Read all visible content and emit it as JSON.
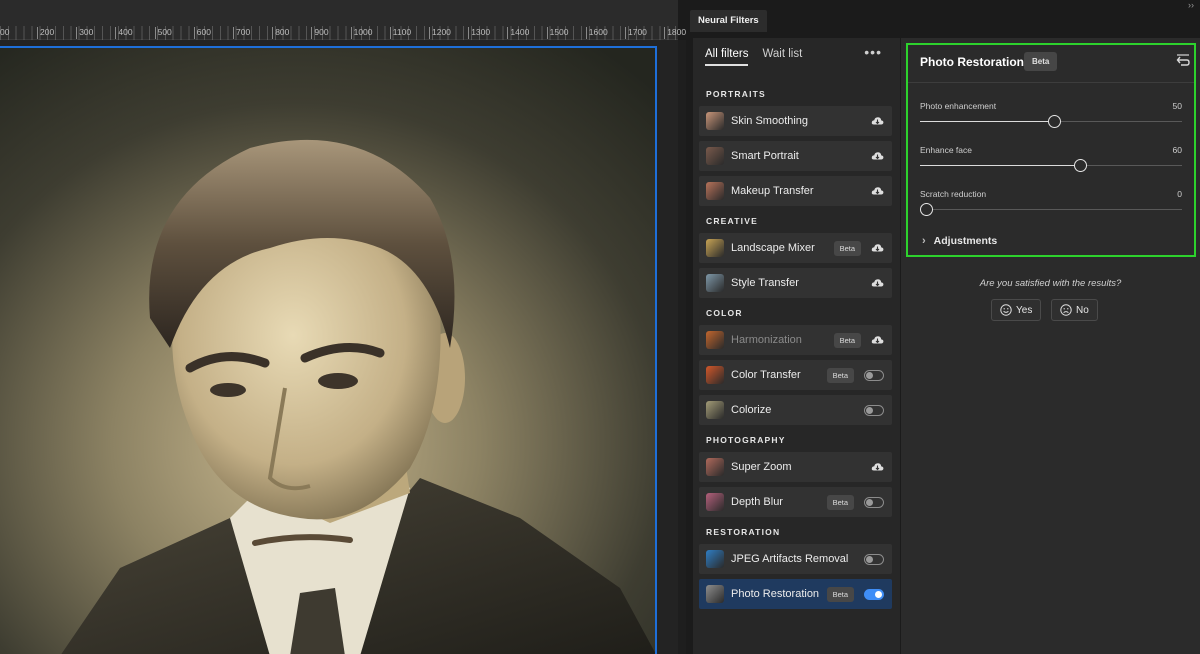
{
  "ruler": {
    "labels": [
      "200",
      "300",
      "400",
      "500",
      "600",
      "700",
      "800",
      "900",
      "1000",
      "1100",
      "1200",
      "1300",
      "1400",
      "1500",
      "1600",
      "1700",
      "1800"
    ],
    "first_partial": "00"
  },
  "header": {
    "title": "Neural Filters",
    "collapse": "››"
  },
  "list": {
    "tabs": [
      {
        "label": "All filters",
        "active": true
      },
      {
        "label": "Wait list",
        "active": false
      }
    ],
    "more": "•••",
    "beta_label": "Beta",
    "sections": [
      {
        "title": "PORTRAITS",
        "items": [
          {
            "name": "Skin Smoothing",
            "control": "cloud",
            "beta": false,
            "dim": false,
            "thumb": "#c9967a"
          },
          {
            "name": "Smart Portrait",
            "control": "cloud",
            "beta": false,
            "dim": false,
            "thumb": "#7a5a4c"
          },
          {
            "name": "Makeup Transfer",
            "control": "cloud",
            "beta": false,
            "dim": false,
            "thumb": "#b8735a"
          }
        ]
      },
      {
        "title": "CREATIVE",
        "items": [
          {
            "name": "Landscape Mixer",
            "control": "cloud",
            "beta": true,
            "dim": false,
            "thumb": "#c8a455"
          },
          {
            "name": "Style Transfer",
            "control": "cloud",
            "beta": false,
            "dim": false,
            "thumb": "#7f98a8"
          }
        ]
      },
      {
        "title": "COLOR",
        "items": [
          {
            "name": "Harmonization",
            "control": "cloud",
            "beta": true,
            "dim": true,
            "thumb": "#c2662e"
          },
          {
            "name": "Color Transfer",
            "control": "toggle-off",
            "beta": true,
            "dim": false,
            "thumb": "#d2572a"
          },
          {
            "name": "Colorize",
            "control": "toggle-off",
            "beta": false,
            "dim": false,
            "thumb": "#a39c78"
          }
        ]
      },
      {
        "title": "PHOTOGRAPHY",
        "items": [
          {
            "name": "Super Zoom",
            "control": "cloud",
            "beta": false,
            "dim": false,
            "thumb": "#b06a5c"
          },
          {
            "name": "Depth Blur",
            "control": "toggle-off",
            "beta": true,
            "dim": false,
            "thumb": "#b4607c"
          }
        ]
      },
      {
        "title": "RESTORATION",
        "items": [
          {
            "name": "JPEG Artifacts Removal",
            "control": "toggle-off",
            "beta": false,
            "dim": false,
            "thumb": "#2f7ec4"
          },
          {
            "name": "Photo Restoration",
            "control": "toggle-on",
            "beta": true,
            "dim": false,
            "thumb": "#8e8e8e",
            "selected": true
          }
        ]
      }
    ]
  },
  "settings": {
    "title": "Photo Restoration",
    "beta": "Beta",
    "sliders": [
      {
        "label": "Photo enhancement",
        "value": "50",
        "level": 0.5
      },
      {
        "label": "Enhance face",
        "value": "60",
        "level": 0.6
      },
      {
        "label": "Scratch reduction",
        "value": "0",
        "level": 0.0
      }
    ],
    "adjustments": "Adjustments",
    "feedback_question": "Are you satisfied with the results?",
    "yes": "Yes",
    "no": "No"
  },
  "colors": {
    "accent": "#3f8ef7",
    "highlight_box": "#2dd22d",
    "canvas_border": "#1e6fd9"
  }
}
